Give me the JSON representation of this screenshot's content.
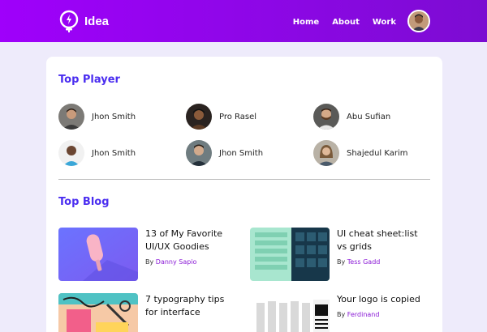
{
  "header": {
    "brand": "Idea",
    "nav": [
      "Home",
      "About",
      "Work"
    ]
  },
  "top_player": {
    "title": "Top Player",
    "players": [
      {
        "name": "Jhon Smith"
      },
      {
        "name": "Pro Rasel"
      },
      {
        "name": "Abu Sufian"
      },
      {
        "name": "Jhon Smith"
      },
      {
        "name": "Jhon Smith"
      },
      {
        "name": "Shajedul Karim"
      }
    ]
  },
  "top_blog": {
    "title": "Top Blog",
    "by_label": "By",
    "posts": [
      {
        "title": "13 of My Favorite UI/UX Goodies",
        "author": "Danny Sapio"
      },
      {
        "title": "UI cheat sheet:list vs grids",
        "author": "Tess Gadd"
      },
      {
        "title": "7 typography tips for interface",
        "author": ""
      },
      {
        "title": "Your logo is copied",
        "author": "Ferdinand"
      }
    ]
  },
  "colors": {
    "header_gradient_start": "#9f00fb",
    "header_gradient_end": "#7c0cd2",
    "page_bg": "#eeebfb",
    "section_title": "#4a2df0",
    "author_link": "#8a1ad6"
  }
}
